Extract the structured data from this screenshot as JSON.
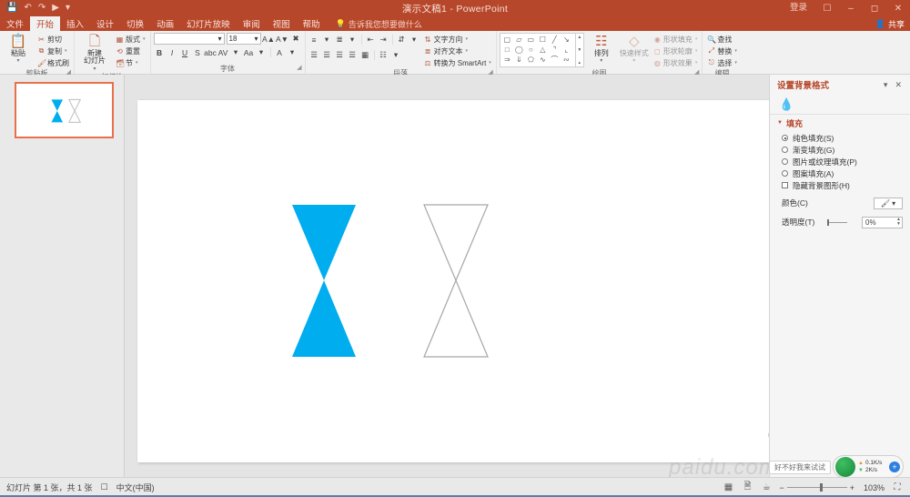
{
  "window": {
    "title": "演示文稿1 - PowerPoint",
    "signin": "登录",
    "share": "共享",
    "qat": [
      "save-icon",
      "undo-icon",
      "redo-icon",
      "start-slideshow-icon",
      "customize-icon"
    ],
    "controls": [
      "ribbon-display-icon",
      "minimize-icon",
      "restore-icon",
      "close-icon"
    ]
  },
  "tabs": [
    {
      "label": "文件",
      "active": false
    },
    {
      "label": "开始",
      "active": true
    },
    {
      "label": "插入",
      "active": false
    },
    {
      "label": "设计",
      "active": false
    },
    {
      "label": "切换",
      "active": false
    },
    {
      "label": "动画",
      "active": false
    },
    {
      "label": "幻灯片放映",
      "active": false
    },
    {
      "label": "审阅",
      "active": false
    },
    {
      "label": "视图",
      "active": false
    },
    {
      "label": "帮助",
      "active": false
    }
  ],
  "tellme": "告诉我您想要做什么",
  "ribbon": {
    "clipboard": {
      "label": "剪贴板",
      "paste": "粘贴",
      "items": [
        "剪切",
        "复制",
        "格式刷"
      ]
    },
    "slides": {
      "label": "幻灯片",
      "new_slide": "新建\n幻灯片",
      "items": [
        "版式",
        "重置",
        "节"
      ]
    },
    "font": {
      "label": "字体",
      "font_name": "",
      "font_size": "18",
      "buttons": [
        "B",
        "I",
        "U",
        "S",
        "abc",
        "文字底纹",
        "Aa",
        "A"
      ]
    },
    "paragraph": {
      "label": "段落",
      "items": [
        "文字方向",
        "对齐文本",
        "转换为 SmartArt"
      ]
    },
    "drawing": {
      "label": "绘图",
      "arrange": "排列",
      "quick_styles": "快速样式",
      "shape_fill": "形状填充",
      "shape_outline": "形状轮廓",
      "shape_effects": "形状效果"
    },
    "editing": {
      "label": "编辑",
      "items": [
        "查找",
        "替换",
        "选择"
      ]
    }
  },
  "pane": {
    "title": "设置背景格式",
    "section": "填充",
    "options": [
      {
        "label": "纯色填充(S)",
        "selected": true
      },
      {
        "label": "渐变填充(G)",
        "selected": false
      },
      {
        "label": "图片或纹理填充(P)",
        "selected": false
      },
      {
        "label": "图案填充(A)",
        "selected": false
      }
    ],
    "hide_graphics": "隐藏背景图形(H)",
    "color_label": "颜色(C)",
    "transparency_label": "透明度(T)",
    "transparency_value": "0%"
  },
  "slide": {
    "shapes": [
      {
        "name": "hourglass-filled",
        "fill": "#00ADEF",
        "stroke": "none"
      },
      {
        "name": "hourglass-outline",
        "fill": "#FFFFFF",
        "stroke": "#A6A6A6"
      }
    ]
  },
  "statusbar": {
    "slide_count": "幻灯片 第 1 张，共 1 张",
    "notes_icon": "notes-icon",
    "language": "中文(中国)",
    "views": [
      "normal-view-icon",
      "slide-sorter-icon",
      "reading-view-icon"
    ],
    "zoom_out": "−",
    "zoom_in": "+",
    "zoom_level": "103%",
    "fit_icon": "fit-to-window-icon"
  },
  "overlay": {
    "watermark": "paidu.com",
    "tag": "好不好我来试试",
    "net_up": "0.1K/s",
    "net_down": "2K/s"
  }
}
